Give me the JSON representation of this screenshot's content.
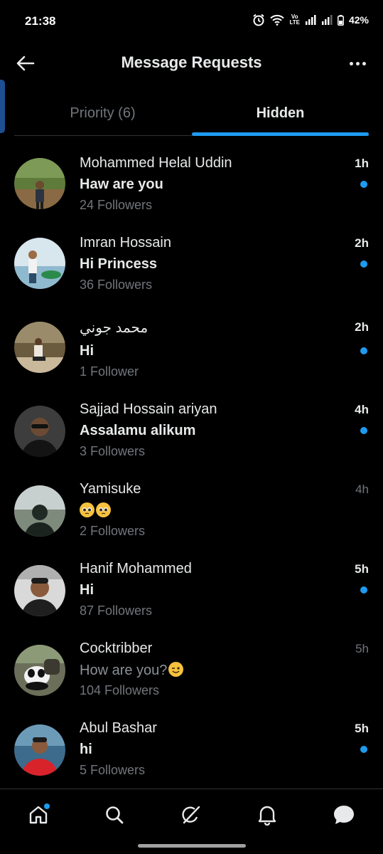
{
  "status_bar": {
    "time": "21:38",
    "volte_line1": "Vo",
    "volte_line2": "LTE",
    "battery": "42%",
    "icons": [
      "alarm-icon",
      "wifi-icon",
      "volte-icon",
      "signal-icon",
      "battery-icon"
    ]
  },
  "header": {
    "title": "Message Requests",
    "back_icon": "arrow-left-icon",
    "more_icon": "more-horizontal-icon"
  },
  "tabs": [
    {
      "label": "Priority (6)",
      "active": false
    },
    {
      "label": "Hidden",
      "active": true
    }
  ],
  "conversations": [
    {
      "name": "Mohammed Helal Uddin",
      "message": "Haw are you",
      "followers": "24 Followers",
      "time": "1h",
      "unread": true
    },
    {
      "name": "Imran Hossain",
      "message": "Hi Princess",
      "followers": "36 Followers",
      "time": "2h",
      "unread": true
    },
    {
      "name": "محمد جوني",
      "message": "Hi",
      "followers": "1 Follower",
      "time": "2h",
      "unread": true
    },
    {
      "name": "Sajjad Hossain ariyan",
      "message": "Assalamu alikum",
      "followers": "3 Followers",
      "time": "4h",
      "unread": true
    },
    {
      "name": "Yamisuke",
      "message": "🥺🥺",
      "followers": "2 Followers",
      "time": "4h",
      "unread": false
    },
    {
      "name": "Hanif Mohammed",
      "message": "Hi",
      "followers": "87 Followers",
      "time": "5h",
      "unread": true
    },
    {
      "name": "Cocktribber",
      "message": "How are you?",
      "message_emoji": "😉",
      "followers": "104 Followers",
      "time": "5h",
      "unread": false
    },
    {
      "name": "Abul Bashar",
      "message": "hi",
      "followers": "5 Followers",
      "time": "5h",
      "unread": true
    }
  ],
  "bottom_nav": [
    {
      "icon": "home-icon",
      "badge": true
    },
    {
      "icon": "search-icon",
      "badge": false
    },
    {
      "icon": "grok-icon",
      "badge": false
    },
    {
      "icon": "bell-icon",
      "badge": false
    },
    {
      "icon": "messages-icon",
      "badge": false,
      "active": true
    }
  ],
  "colors": {
    "background": "#000000",
    "accent": "#1d9bf0",
    "primary_text": "#e7e9ea",
    "secondary_text": "#71767b",
    "divider": "#2f3336"
  }
}
